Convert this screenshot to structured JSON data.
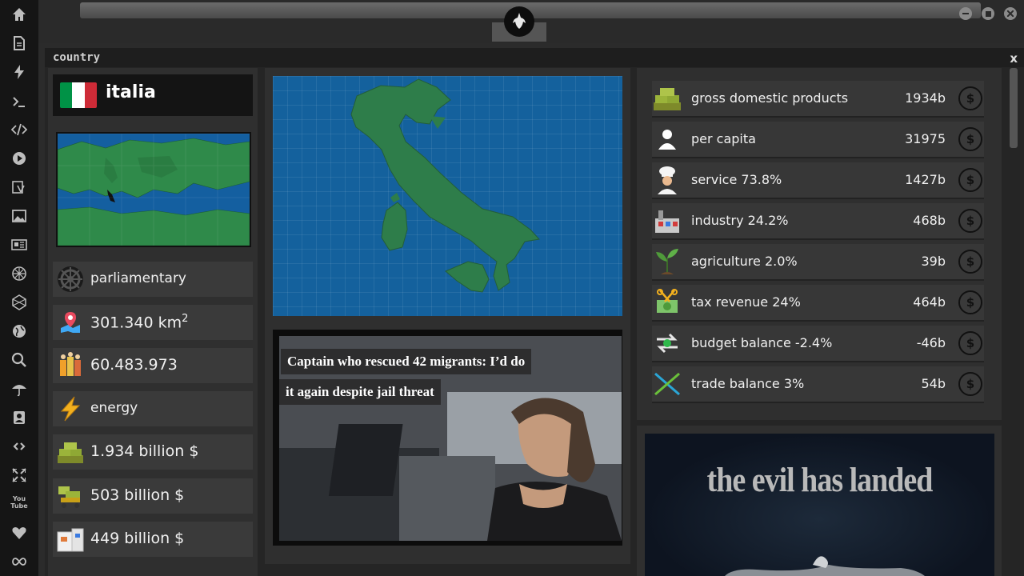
{
  "sidebar": {
    "icons": [
      "home-icon",
      "document-icon",
      "lightning-icon",
      "terminal-icon",
      "code-icon",
      "play-icon",
      "translate-icon",
      "image-icon",
      "newspaper-icon",
      "rebel-icon",
      "hex-icon",
      "globe-icon",
      "search-icon",
      "umbrella-icon",
      "contact-icon",
      "link-icon",
      "expand-icon",
      "youtube-icon",
      "heart-icon",
      "infinity-icon"
    ],
    "youtube_label": "You Tube"
  },
  "window": {
    "title": "country",
    "close": "x"
  },
  "country": {
    "name": "italia",
    "flag_colors": [
      "#009246",
      "#ffffff",
      "#ce2b37"
    ],
    "government": "parliamentary",
    "area_value": "301.340 km",
    "area_sup": "2",
    "population": "60.483.973",
    "energy": "energy",
    "gdp_total": "1.934 billion $",
    "value2": "503 billion $",
    "value3": "449 billion $"
  },
  "news": {
    "headline_line1": "Captain who rescued 42 migrants: I’d do",
    "headline_line2": "it again despite jail threat"
  },
  "economy": [
    {
      "label": "gross domestic products",
      "value": "1934b",
      "icon": "money-stack-icon"
    },
    {
      "label": "per capita",
      "value": "31975",
      "icon": "person-icon"
    },
    {
      "label": "service 73.8%",
      "value": "1427b",
      "icon": "chef-icon"
    },
    {
      "label": "industry 24.2%",
      "value": "468b",
      "icon": "factory-icon"
    },
    {
      "label": "agriculture 2.0%",
      "value": "39b",
      "icon": "plant-icon"
    },
    {
      "label": "tax revenue 24%",
      "value": "464b",
      "icon": "tax-icon"
    },
    {
      "label": "budget balance -2.4%",
      "value": "-46b",
      "icon": "balance-arrows-icon"
    },
    {
      "label": "trade balance 3%",
      "value": "54b",
      "icon": "trade-icon"
    }
  ],
  "coin_symbol": "$",
  "poster": {
    "title": "the evil has landed"
  }
}
